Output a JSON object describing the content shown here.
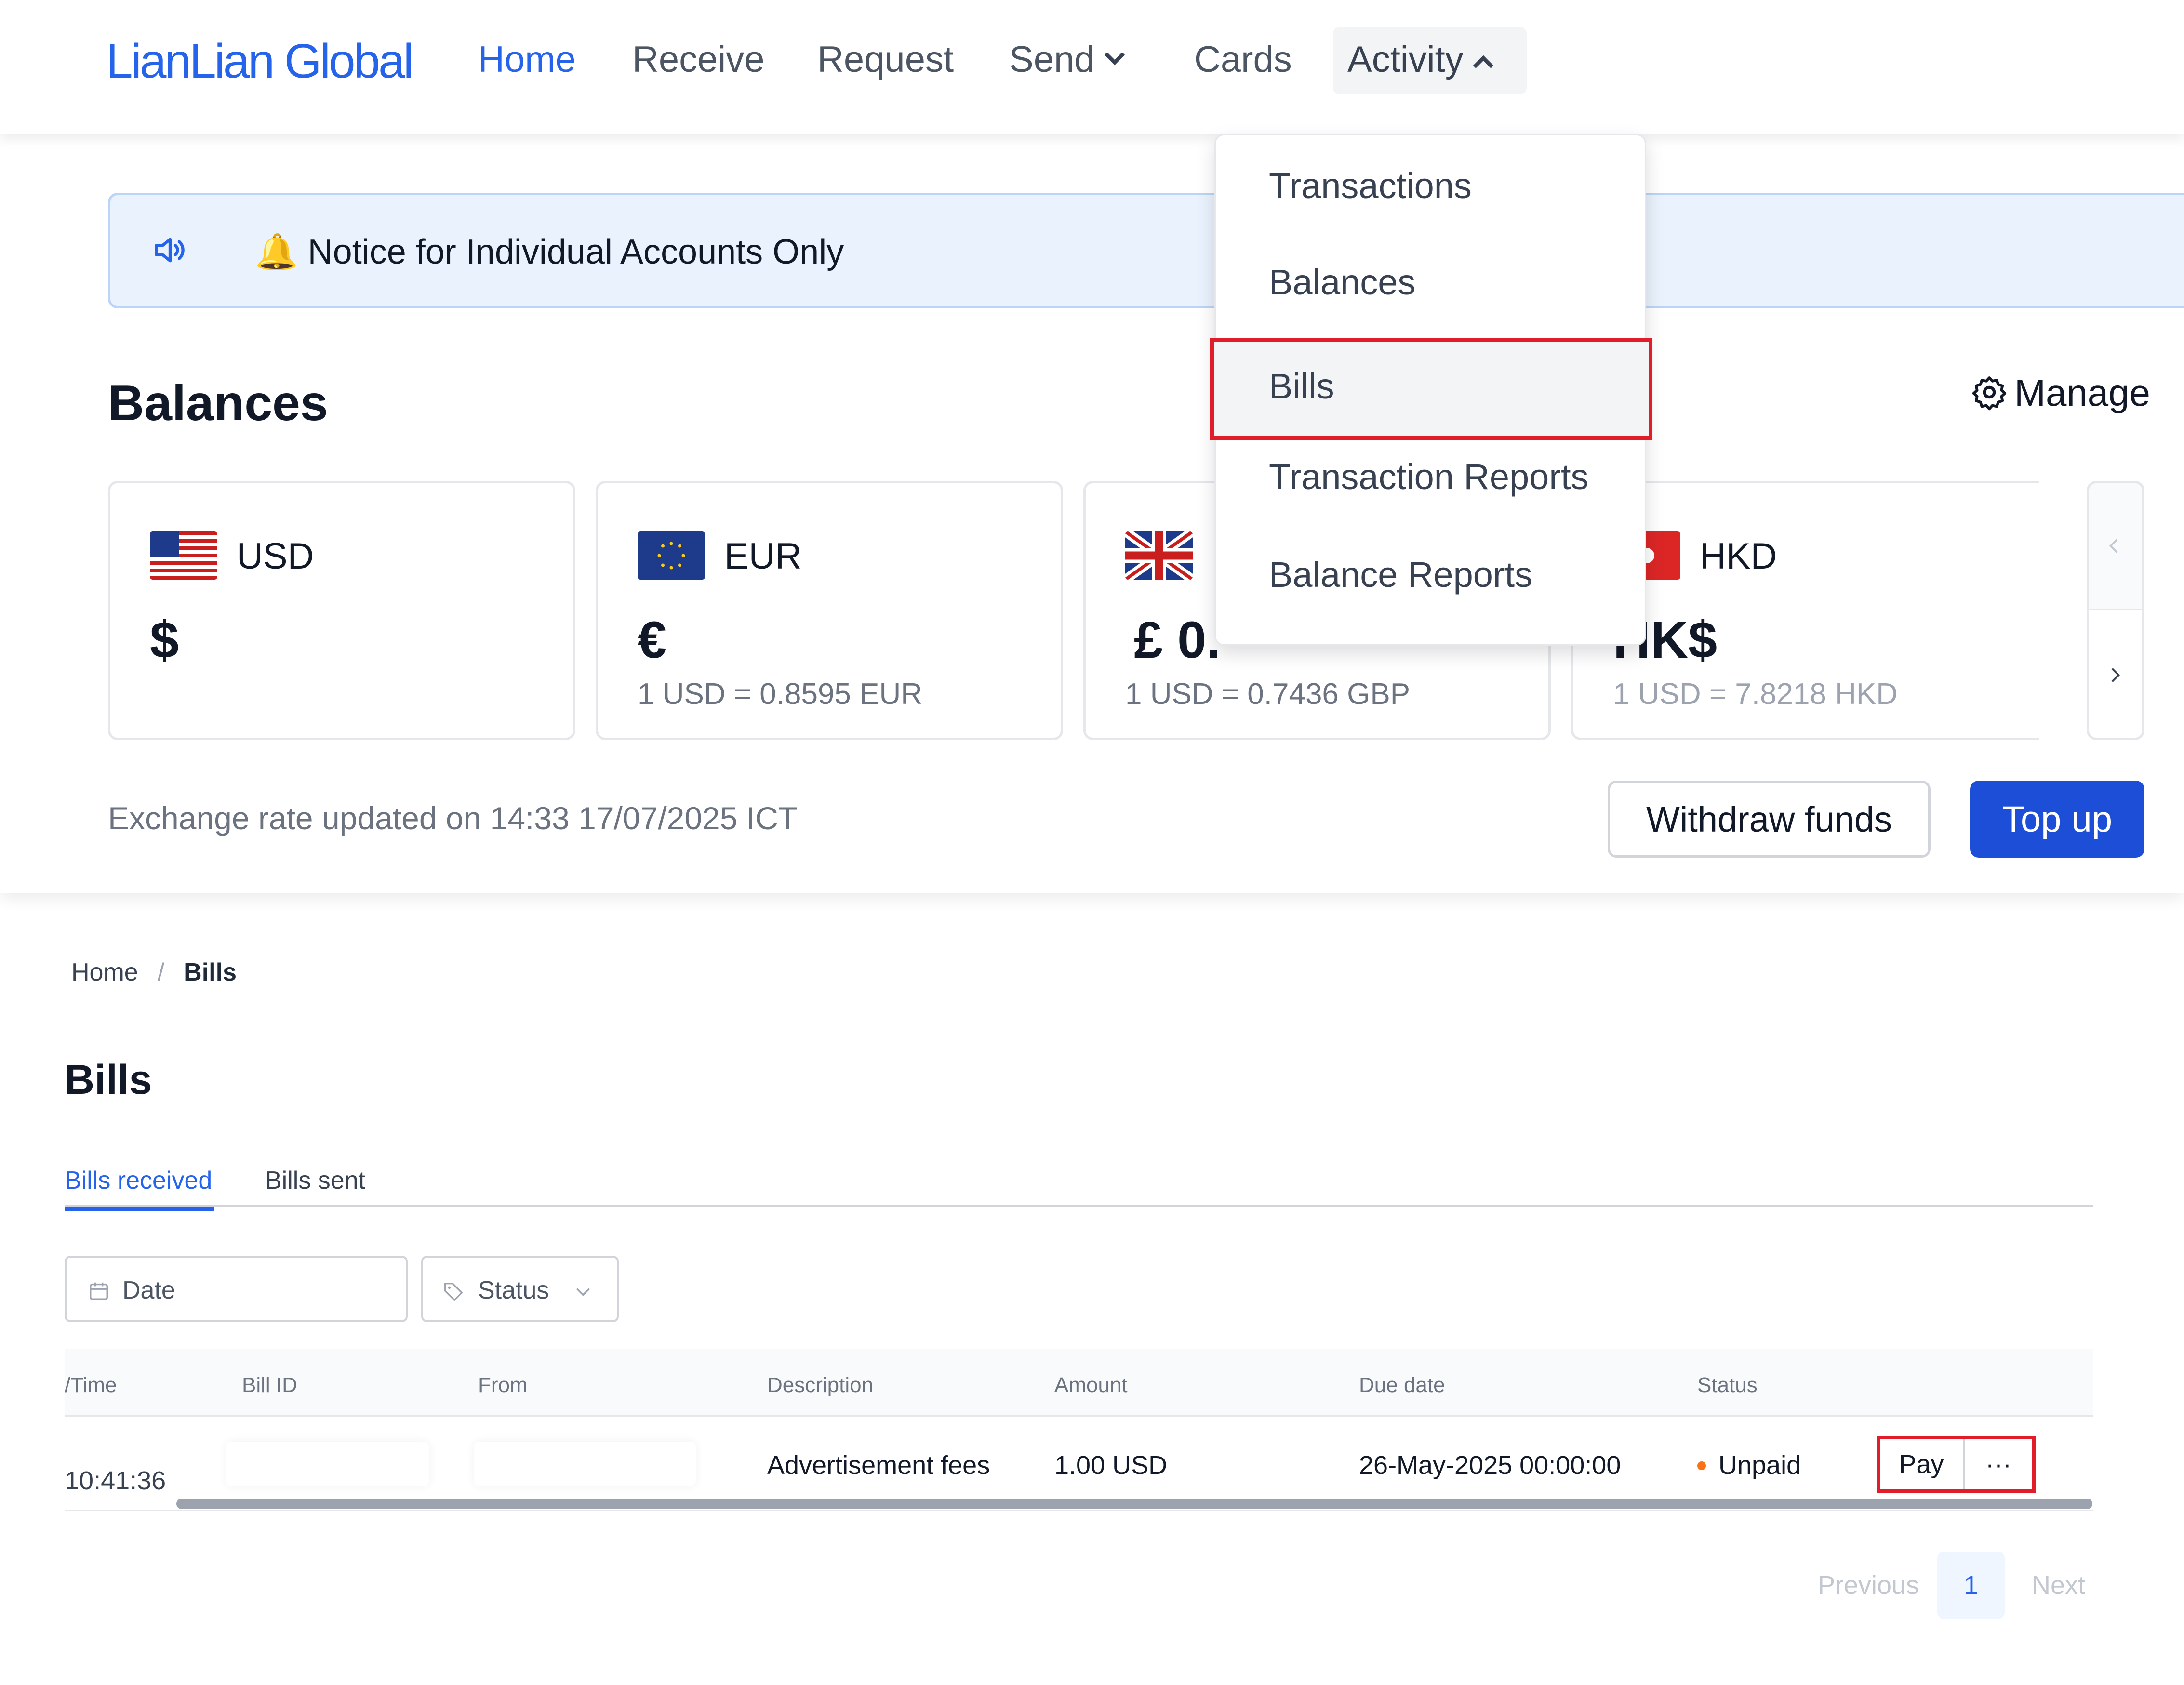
{
  "nav": {
    "logo": "LianLian Global",
    "items": [
      {
        "label": "Home"
      },
      {
        "label": "Receive"
      },
      {
        "label": "Request"
      },
      {
        "label": "Send"
      },
      {
        "label": "Cards"
      },
      {
        "label": "Activity"
      }
    ],
    "active": "Home",
    "open_menu": "Activity"
  },
  "activity_menu": {
    "items": [
      {
        "label": "Transactions"
      },
      {
        "label": "Balances"
      },
      {
        "label": "Bills"
      },
      {
        "label": "Transaction Reports"
      },
      {
        "label": "Balance Reports"
      }
    ],
    "highlighted": "Bills"
  },
  "notice": {
    "text": "🔔 Notice for Individual Accounts Only"
  },
  "balances": {
    "title": "Balances",
    "manage_label": "Manage",
    "cards": [
      {
        "currency": "USD",
        "symbol": "$",
        "rate": "",
        "flag": "us-flag-icon"
      },
      {
        "currency": "EUR",
        "symbol": "€",
        "rate": "1 USD = 0.8595 EUR",
        "flag": "eu-flag-icon"
      },
      {
        "currency": "",
        "symbol": "£ 0.",
        "rate": "1 USD = 0.7436 GBP",
        "flag": "uk-flag-icon"
      },
      {
        "currency": "HKD",
        "symbol": "HK$",
        "rate": "1 USD = 7.8218 HKD",
        "flag": "hk-flag-icon"
      }
    ],
    "rate_updated": "Exchange rate updated on 14:33 17/07/2025 ICT",
    "withdraw_label": "Withdraw funds",
    "topup_label": "Top up"
  },
  "breadcrumb": {
    "home": "Home",
    "current": "Bills"
  },
  "bills": {
    "title": "Bills",
    "tabs": [
      {
        "label": "Bills received"
      },
      {
        "label": "Bills sent"
      }
    ],
    "active_tab": "Bills received",
    "filters": {
      "date_placeholder": "Date",
      "status_placeholder": "Status"
    },
    "columns": [
      "/Time",
      "Bill ID",
      "From",
      "Description",
      "Amount",
      "Due date",
      "Status"
    ],
    "rows": [
      {
        "time": "10:41:36",
        "bill_id": "",
        "from": "",
        "description": "Advertisement fees",
        "amount": "1.00 USD",
        "due_date": "26-May-2025 00:00:00",
        "status": "Unpaid",
        "pay_label": "Pay",
        "more_label": "···"
      }
    ]
  },
  "pagination": {
    "previous": "Previous",
    "page": "1",
    "next": "Next"
  },
  "colors": {
    "accent": "#2563eb",
    "highlight_border": "#e11d2a",
    "status_unpaid": "#f97316"
  }
}
